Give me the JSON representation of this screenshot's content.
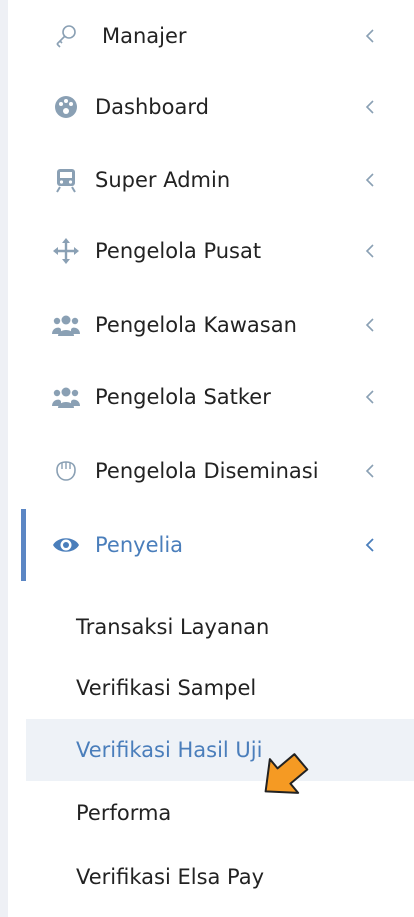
{
  "menu": {
    "items": [
      {
        "label": "Manajer",
        "icon": "key-icon"
      },
      {
        "label": "Dashboard",
        "icon": "palette-icon"
      },
      {
        "label": "Super Admin",
        "icon": "train-icon"
      },
      {
        "label": "Pengelola Pusat",
        "icon": "move-arrows-icon"
      },
      {
        "label": "Pengelola Kawasan",
        "icon": "users-icon"
      },
      {
        "label": "Pengelola Satker",
        "icon": "users-icon"
      },
      {
        "label": "Pengelola Diseminasi",
        "icon": "hand-paper-icon"
      },
      {
        "label": "Penyelia",
        "icon": "eye-icon",
        "active": true
      }
    ],
    "submenu": [
      {
        "label": "Transaksi Layanan"
      },
      {
        "label": "Verifikasi Sampel"
      },
      {
        "label": "Verifikasi Hasil Uji",
        "hovered": true
      },
      {
        "label": "Performa"
      },
      {
        "label": "Verifikasi Elsa Pay"
      }
    ]
  },
  "colors": {
    "text": "#222222",
    "accent": "#4a7ebb",
    "icon": "#8aa0b4",
    "hover_bg": "#eef2f7",
    "cursor": "#f59a23"
  }
}
